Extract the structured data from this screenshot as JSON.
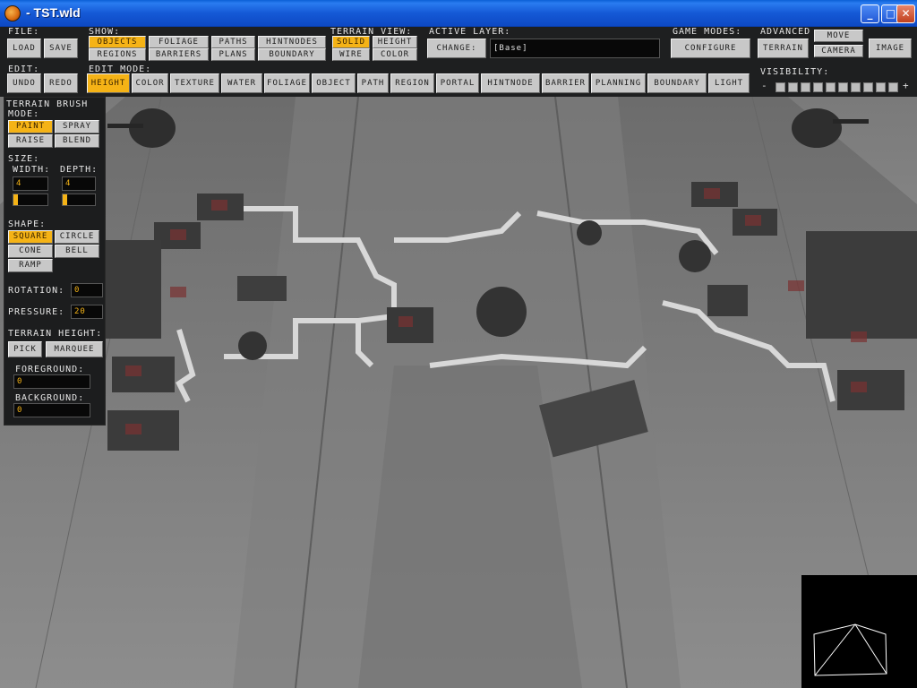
{
  "window": {
    "title": "- TST.wld",
    "icon": "app-icon",
    "controls": {
      "minimize": "_",
      "maximize": "□",
      "close": "✕"
    }
  },
  "colors": {
    "active": "#f5b316",
    "toolbar_bg": "#1e1f20",
    "button": "#c8c8c8",
    "title_bar": "#1559d6"
  },
  "toolbar": {
    "file": {
      "label": "File:",
      "buttons": [
        "Load",
        "Save"
      ]
    },
    "show": {
      "label": "Show:",
      "row1": [
        "Objects",
        "Foliage",
        "Paths",
        "HintNodes"
      ],
      "row2": [
        "Regions",
        "Barriers",
        "Plans",
        "Boundary"
      ],
      "active": [
        "Objects"
      ]
    },
    "terrain_view": {
      "label": "Terrain View:",
      "row1": [
        "Solid",
        "Height"
      ],
      "row2": [
        "Wire",
        "Color"
      ],
      "active": [
        "Solid"
      ]
    },
    "active_layer": {
      "label": "Active Layer:",
      "change_label": "Change:",
      "value": "[Base]"
    },
    "game_modes": {
      "label": "Game Modes:",
      "configure": "Configure"
    },
    "advanced": {
      "label": "Advanced",
      "terrain": "Terrain",
      "move": "Move",
      "camera": "Camera",
      "image": "Image"
    },
    "edit": {
      "label": "Edit:",
      "buttons": [
        "Undo",
        "Redo"
      ]
    },
    "edit_mode": {
      "label": "Edit Mode:",
      "buttons": [
        "Height",
        "Color",
        "Texture",
        "Water",
        "Foliage",
        "Object",
        "Path",
        "Region",
        "Portal",
        "HintNode",
        "Barrier",
        "Planning",
        "Boundary",
        "Light"
      ],
      "active": "Height"
    },
    "visibility": {
      "label": "Visibility:",
      "minus": "-",
      "plus": "+"
    }
  },
  "brush": {
    "title": "Terrain Brush",
    "mode_label": "Mode:",
    "modes": [
      "Paint",
      "Spray",
      "Raise",
      "Blend"
    ],
    "active_mode": "Paint",
    "size_label": "Size:",
    "width_label": "Width:",
    "depth_label": "Depth:",
    "width": "4",
    "depth": "4",
    "shape_label": "Shape:",
    "shapes": [
      "Square",
      "Circle",
      "Cone",
      "Bell",
      "Ramp"
    ],
    "active_shape": "Square",
    "rotation_label": "Rotation:",
    "rotation": "0",
    "pressure_label": "Pressure:",
    "pressure": "20",
    "terrain_height_label": "Terrain Height:",
    "pick": "Pick",
    "marquee": "Marquee",
    "foreground_label": "Foreground:",
    "foreground": "0",
    "background_label": "Background:",
    "background": "0"
  }
}
